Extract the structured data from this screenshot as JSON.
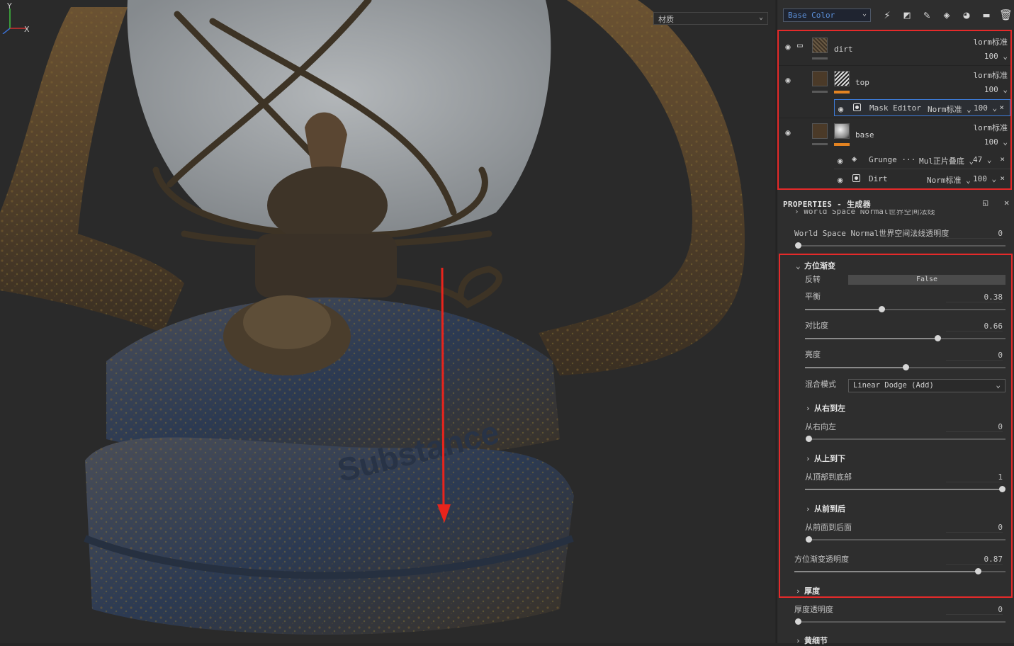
{
  "viewport": {
    "material_select": "材质",
    "axis_y": "Y",
    "axis_x": "X"
  },
  "toolbar": {
    "channel": "Base Color",
    "icons": [
      "magic-wand-icon",
      "mask-icon",
      "brush-icon",
      "fill-icon",
      "palette-icon",
      "folder-icon",
      "trash-icon"
    ]
  },
  "layers": {
    "dirt": {
      "name": "dirt",
      "blend": "lorm标准",
      "opacity": "100"
    },
    "top": {
      "name": "top",
      "blend": "lorm标准",
      "opacity": "100"
    },
    "top_mask": {
      "name": "Mask Editor",
      "blend": "Norm标准",
      "opacity": "100"
    },
    "base": {
      "name": "base",
      "blend": "lorm标准",
      "opacity": "100"
    },
    "grunge": {
      "name": "Grunge ···",
      "blend": "Mul正片叠底",
      "opacity": "47"
    },
    "dirt_mask": {
      "name": "Dirt",
      "blend": "Norm标准",
      "opacity": "100"
    }
  },
  "properties": {
    "header": "PROPERTIES - 生成器",
    "cutoff_section": "World Space Normal世界空间法线",
    "wsn_label": "World Space Normal世界空间法线透明度",
    "wsn_value": "0",
    "wsn_level": 0,
    "position_gradient": {
      "title": "方位渐变",
      "invert_label": "反转",
      "invert_value": "False",
      "balance_label": "平衡",
      "balance_value": "0.38",
      "balance_level": 0.38,
      "contrast_label": "对比度",
      "contrast_value": "0.66",
      "contrast_level": 0.66,
      "brightness_label": "亮度",
      "brightness_value": "0",
      "brightness_level": 0.5,
      "blend_label": "混合模式",
      "blend_value": "Linear Dodge (Add)",
      "rtl_section": "从右到左",
      "rtl_label": "从右向左",
      "rtl_value": "0",
      "rtl_level": 0,
      "ttb_section": "从上到下",
      "ttb_label": "从顶部到底部",
      "ttb_value": "1",
      "ttb_level": 1,
      "ftb_section": "从前到后",
      "ftb_label": "从前面到后面",
      "ftb_value": "0",
      "ftb_level": 0,
      "opacity_label": "方位渐变透明度",
      "opacity_value": "0.87",
      "opacity_level": 0.87
    },
    "thickness_section": "厚度",
    "thickness_label": "厚度透明度",
    "thickness_value": "0",
    "thickness_level": 0,
    "detail_section": "黄细节"
  },
  "colors": {
    "highlight_box": "#e52a2a",
    "selection": "#3d7ad6",
    "channel_text": "#5b8fd8",
    "arrow": "#e8241c"
  }
}
